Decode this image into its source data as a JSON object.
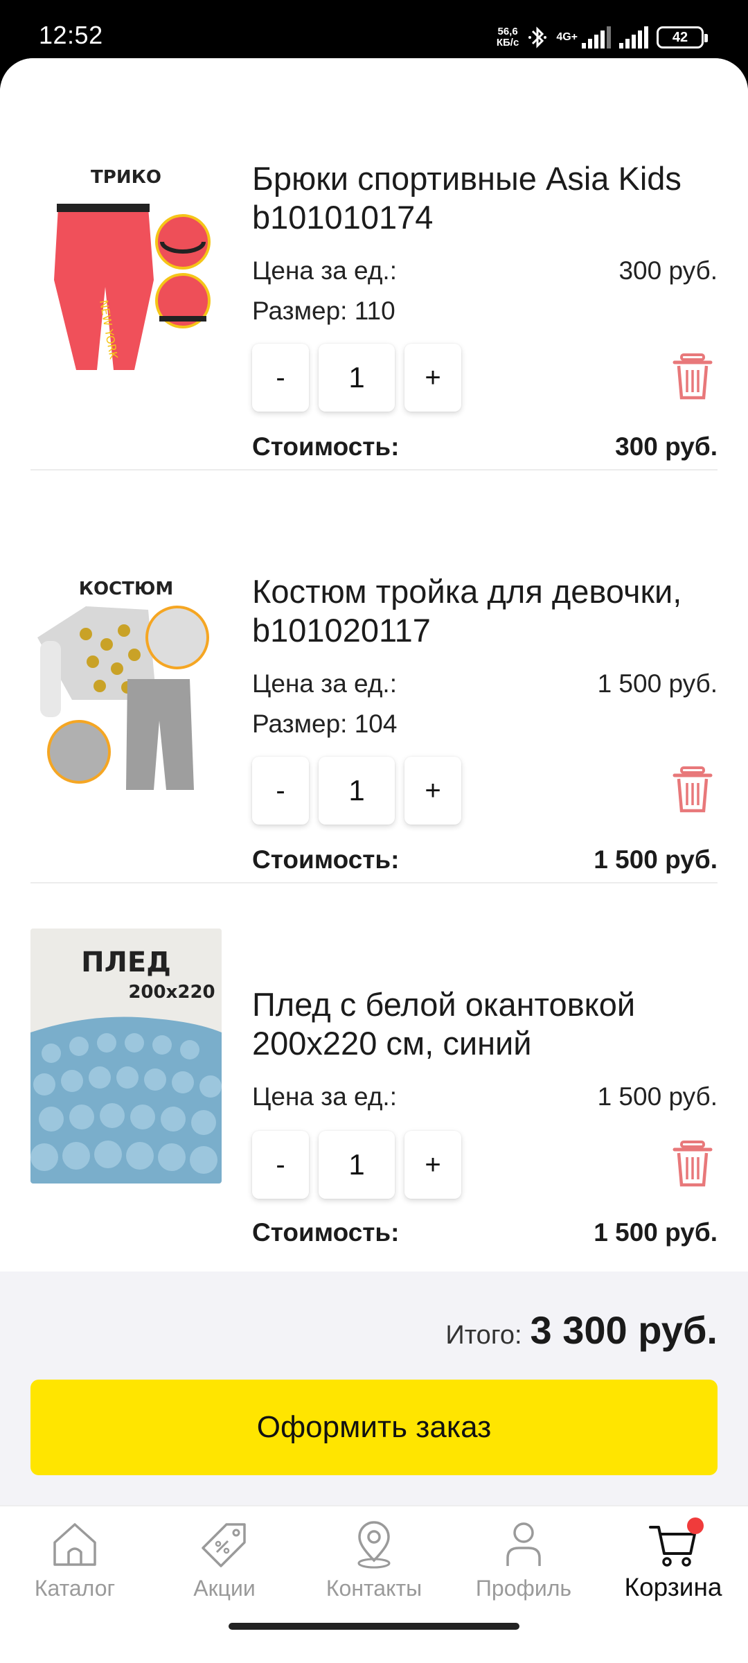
{
  "status_bar": {
    "time": "12:52",
    "net_speed_value": "56,6",
    "net_speed_unit": "КБ/с",
    "network_type": "4G+",
    "battery": "42"
  },
  "cart": {
    "items": [
      {
        "image_caption": "ТРИКО",
        "title": "Брюки спортивные Asia Kids b101010174",
        "unit_price_label": "Цена за ед.:",
        "unit_price": "300 руб.",
        "size_label": "Размер: 110",
        "qty_minus": "-",
        "qty": "1",
        "qty_plus": "+",
        "cost_label": "Стоимость:",
        "cost": "300 руб."
      },
      {
        "image_caption": "КОСТЮМ",
        "title": "Костюм тройка для девочки, b101020117",
        "unit_price_label": "Цена за ед.:",
        "unit_price": "1 500 руб.",
        "size_label": "Размер: 104",
        "qty_minus": "-",
        "qty": "1",
        "qty_plus": "+",
        "cost_label": "Стоимость:",
        "cost": "1 500 руб."
      },
      {
        "image_caption": "ПЛЕД",
        "image_caption_2": "200x220",
        "title": "Плед с белой окантовкой 200x220 см, синий",
        "unit_price_label": "Цена за ед.:",
        "unit_price": "1 500 руб.",
        "qty_minus": "-",
        "qty": "1",
        "qty_plus": "+",
        "cost_label": "Стоимость:",
        "cost": "1 500 руб."
      }
    ],
    "total_label": "Итого:",
    "total_value": "3 300 руб.",
    "order_button": "Оформить заказ"
  },
  "bottom_nav": {
    "items": [
      {
        "label": "Каталог",
        "icon": "home-icon"
      },
      {
        "label": "Акции",
        "icon": "tag-icon"
      },
      {
        "label": "Контакты",
        "icon": "location-pin-icon"
      },
      {
        "label": "Профиль",
        "icon": "person-icon"
      },
      {
        "label": "Корзина",
        "icon": "cart-icon",
        "active": true,
        "badge": true
      }
    ]
  },
  "colors": {
    "accent_yellow": "#ffe500",
    "trash_red": "#e8787a",
    "badge_red": "#f03b3b",
    "inactive_nav": "#9a9a9a",
    "total_bg": "#f3f3f7"
  }
}
